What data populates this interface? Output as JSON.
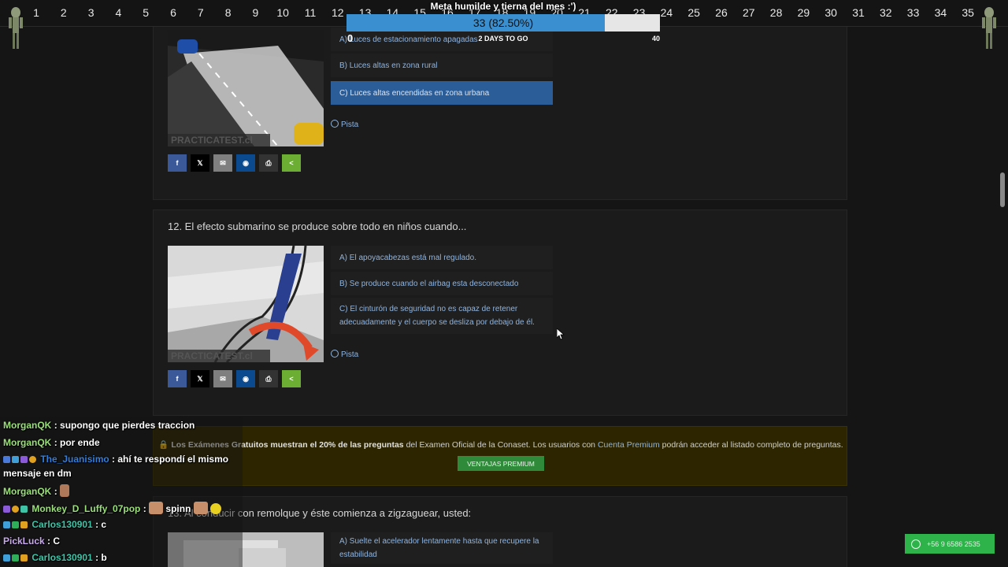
{
  "topbar": {
    "numbers": [
      "1",
      "2",
      "3",
      "4",
      "5",
      "6",
      "7",
      "8",
      "9",
      "10",
      "11",
      "12",
      "13",
      "14",
      "15",
      "16",
      "17",
      "18",
      "19",
      "20",
      "21",
      "22",
      "23",
      "24",
      "25",
      "26",
      "27",
      "28",
      "29",
      "30",
      "31",
      "32",
      "33",
      "34",
      "35"
    ]
  },
  "goal": {
    "title": "Meta humilde y tierna del mes :')",
    "progress_text": "33 (82.50%)",
    "progress_fraction": 0.825,
    "start": "0",
    "days_left": "2 DAYS TO GO",
    "target": "40"
  },
  "question11": {
    "options": [
      {
        "label": "A) Luces de estacionamiento apagadas",
        "selected": false
      },
      {
        "label": "B) Luces altas en zona rural",
        "selected": false
      },
      {
        "label": "C) Luces altas encendidas en zona urbana",
        "selected": true
      }
    ],
    "hint": "Pista",
    "watermark": "PRACTICATEST.cl"
  },
  "question12": {
    "text": "12. El efecto submarino se produce sobre todo en niños cuando...",
    "options": [
      {
        "label": "A) El apoyacabezas está mal regulado.",
        "selected": false
      },
      {
        "label": "B) Se produce cuando el airbag esta desconectado",
        "selected": false
      },
      {
        "label": "C) El cinturón de seguridad no es capaz de retener adecuadamente y el cuerpo se desliza por debajo de él.",
        "selected": false
      }
    ],
    "hint": "Pista",
    "watermark": "PRACTICATEST.cl"
  },
  "share": {
    "buttons": [
      {
        "icon": "facebook-icon",
        "glyph": "f",
        "color": "#3b5998"
      },
      {
        "icon": "x-icon",
        "glyph": "𝕏",
        "color": "#000000"
      },
      {
        "icon": "email-icon",
        "glyph": "✉",
        "color": "#7f7f7f"
      },
      {
        "icon": "messenger-icon",
        "glyph": "◉",
        "color": "#0b4a8f"
      },
      {
        "icon": "print-icon",
        "glyph": "⎙",
        "color": "#333333"
      },
      {
        "icon": "share-icon",
        "glyph": "<",
        "color": "#6cae33"
      }
    ]
  },
  "premium": {
    "part1": "Los Exámenes",
    "part2": "Gratuitos muestran el 20% de las preguntas",
    "part3": "del Examen Oficial de la Conaset. Los usuarios con",
    "link": "Cuenta Premium",
    "part4": "podrán acceder al listado completo de preguntas.",
    "button": "VENTAJAS PREMIUM"
  },
  "question13": {
    "text": "13. Al conducir con remolque y éste comienza a zigzaguear, usted:",
    "options": [
      {
        "label": "A) Suelte el acelerador lentamente hasta que recupere la estabilidad",
        "selected": false
      }
    ]
  },
  "chat": {
    "messages": [
      {
        "user": "MorganQK",
        "color": "#9be07a",
        "text": ": supongo que pierdes traccion"
      },
      {
        "user": "MorganQK",
        "color": "#9be07a",
        "text": ": por ende"
      },
      {
        "user": "The_Juanisimo",
        "color": "#2f7fe0",
        "text": ": ahí te respondí el mismo",
        "text2": "mensaje en dm"
      },
      {
        "user": "MorganQK",
        "color": "#9be07a",
        "text": ":"
      },
      {
        "user": "Monkey_D_Luffy_07pop",
        "color": "#9be07a",
        "text": ":",
        "emote": "spinn"
      },
      {
        "user": "Carlos130901",
        "color": "#3fc4a8",
        "text": ": c"
      },
      {
        "user": "PickLuck",
        "color": "#c9a8f0",
        "text": ": C"
      },
      {
        "user": "Carlos130901",
        "color": "#3fc4a8",
        "text": ": b"
      }
    ]
  },
  "whatsapp": {
    "label": "+56 9 6586 2535"
  }
}
